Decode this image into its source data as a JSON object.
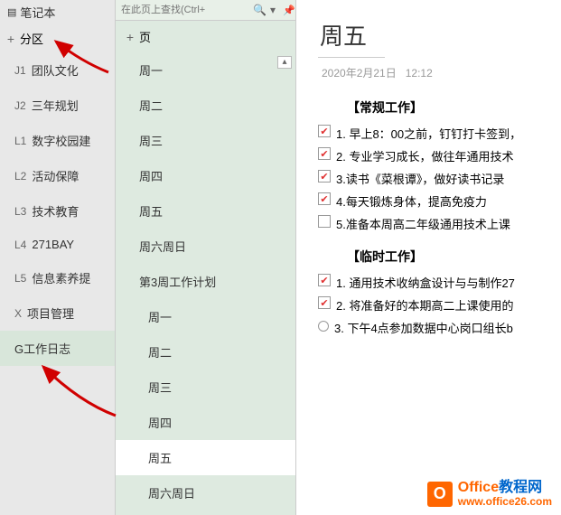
{
  "notebook_header": "笔记本",
  "sections_header": "分区",
  "sections": [
    {
      "code": "J1",
      "label": "团队文化"
    },
    {
      "code": "J2",
      "label": "三年规划"
    },
    {
      "code": "L1",
      "label": "数字校园建"
    },
    {
      "code": "L2",
      "label": "活动保障"
    },
    {
      "code": "L3",
      "label": "技术教育"
    },
    {
      "code": "L4",
      "label": "271BAY"
    },
    {
      "code": "L5",
      "label": "信息素养提"
    },
    {
      "code": "X",
      "label": "项目管理"
    },
    {
      "code": "",
      "label": "G工作日志"
    }
  ],
  "search": {
    "placeholder": "在此页上查找(Ctrl+"
  },
  "pages_header": "页",
  "pages": [
    {
      "label": "周一",
      "sub": false,
      "selected": false
    },
    {
      "label": "周二",
      "sub": false,
      "selected": false
    },
    {
      "label": "周三",
      "sub": false,
      "selected": false
    },
    {
      "label": "周四",
      "sub": false,
      "selected": false
    },
    {
      "label": "周五",
      "sub": false,
      "selected": false
    },
    {
      "label": "周六周日",
      "sub": false,
      "selected": false
    },
    {
      "label": "第3周工作计划",
      "sub": false,
      "selected": false
    },
    {
      "label": "周一",
      "sub": true,
      "selected": false
    },
    {
      "label": "周二",
      "sub": true,
      "selected": false
    },
    {
      "label": "周三",
      "sub": true,
      "selected": false
    },
    {
      "label": "周四",
      "sub": true,
      "selected": false
    },
    {
      "label": "周五",
      "sub": true,
      "selected": true
    },
    {
      "label": "周六周日",
      "sub": true,
      "selected": false
    }
  ],
  "content": {
    "title": "周五",
    "date": "2020年2月21日",
    "time": "12:12",
    "routine_heading": "【常规工作】",
    "routine_tasks": [
      {
        "checked": true,
        "text": "1. 早上8：00之前，钉钉打卡签到，"
      },
      {
        "checked": true,
        "text": "2. 专业学习成长，做往年通用技术"
      },
      {
        "checked": true,
        "text": "3.读书《菜根谭》，做好读书记录"
      },
      {
        "checked": true,
        "text": "4.每天锻炼身体，提高免疫力"
      },
      {
        "checked": false,
        "text": "5.准备本周高二年级通用技术上课"
      }
    ],
    "temp_heading": "【临时工作】",
    "temp_tasks": [
      {
        "checked": true,
        "text": "1. 通用技术收纳盒设计与与制作27"
      },
      {
        "checked": true,
        "text": "2. 将准备好的本期高二上课使用的"
      },
      {
        "checked": "radio",
        "text": "3. 下午4点参加数据中心岗口组长b"
      }
    ]
  },
  "watermark": {
    "logo_letter": "O",
    "brand_orange": "Office",
    "brand_blue": "教程网",
    "url": "www.office26.com"
  }
}
